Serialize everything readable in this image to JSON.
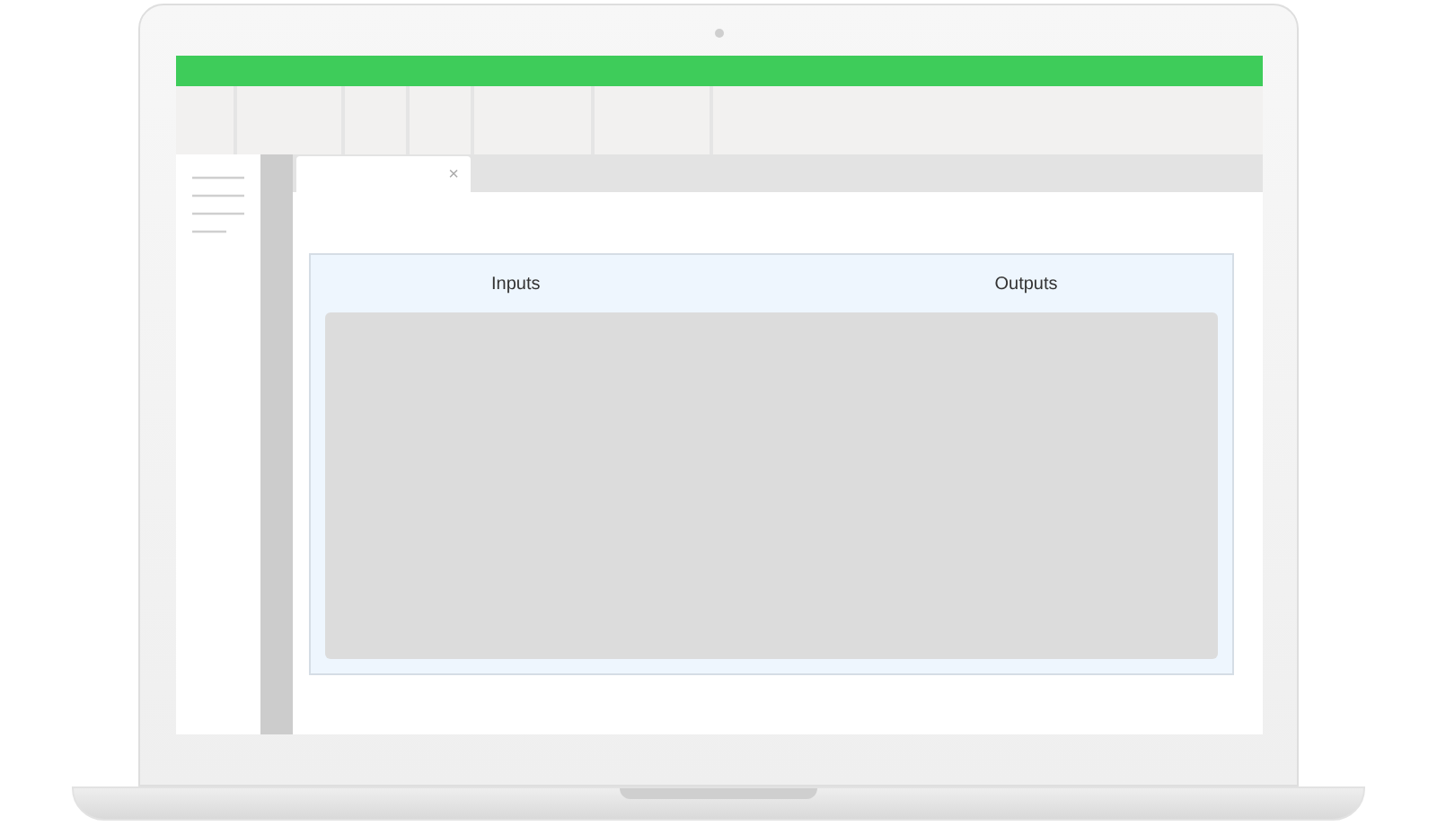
{
  "tabs": [
    {
      "close": "×",
      "selected": true
    }
  ],
  "panel": {
    "columns": [
      "Inputs",
      "Outputs"
    ]
  }
}
